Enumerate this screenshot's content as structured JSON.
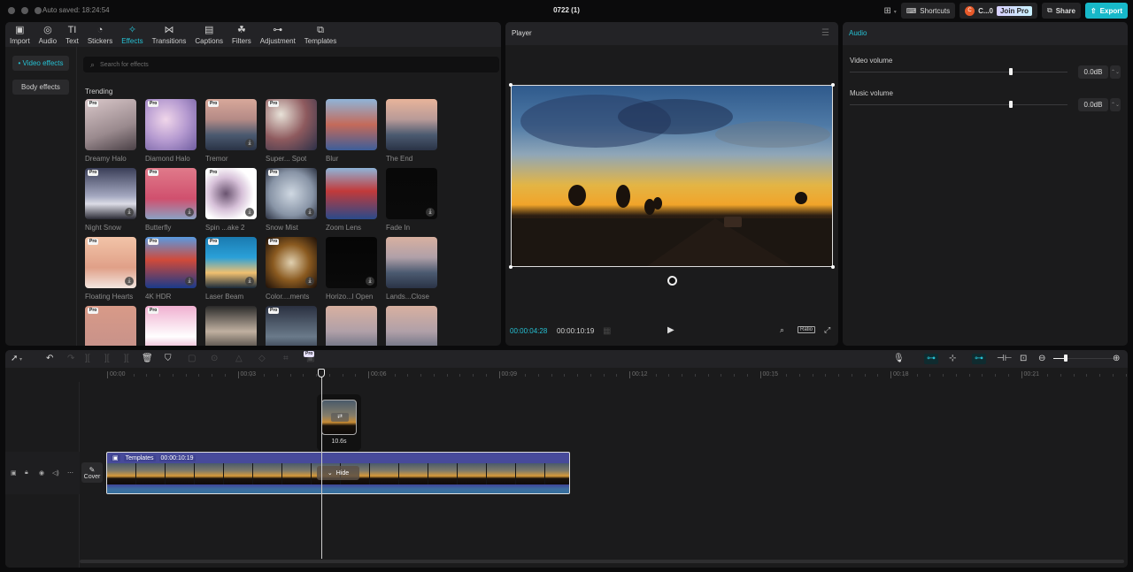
{
  "titlebar": {
    "autosaved": "Auto saved: 18:24:54",
    "doc_title": "0722 (1)",
    "layout_icon": "layout-icon",
    "shortcuts_label": "Shortcuts",
    "user_initial": "C",
    "user_name": "C...0",
    "join_pro_label": "Join Pro",
    "share_label": "Share",
    "export_label": "Export"
  },
  "topnav": [
    {
      "icon": "▣",
      "label": "Import"
    },
    {
      "icon": "◎",
      "label": "Audio"
    },
    {
      "icon": "TI",
      "label": "Text"
    },
    {
      "icon": "◔",
      "label": "Stickers"
    },
    {
      "icon": "✧",
      "label": "Effects",
      "active": true
    },
    {
      "icon": "⋈",
      "label": "Transitions"
    },
    {
      "icon": "▤",
      "label": "Captions"
    },
    {
      "icon": "☘",
      "label": "Filters"
    },
    {
      "icon": "⊶",
      "label": "Adjustment"
    },
    {
      "icon": "⧉",
      "label": "Templates"
    }
  ],
  "subnav": {
    "video_effects": "• Video effects",
    "body_effects": "Body effects"
  },
  "effects": {
    "search_placeholder": "Search for effects",
    "section_title": "Trending",
    "items": [
      {
        "label": "Dreamy Halo",
        "pro": true,
        "download": false
      },
      {
        "label": "Diamond Halo",
        "pro": true,
        "download": false
      },
      {
        "label": "Tremor",
        "pro": true,
        "download": true
      },
      {
        "label": "Super... Spot",
        "pro": true,
        "download": false
      },
      {
        "label": "Blur",
        "pro": false,
        "download": false
      },
      {
        "label": "The End",
        "pro": false,
        "download": false
      },
      {
        "label": "Night Snow",
        "pro": true,
        "download": true
      },
      {
        "label": "Butterfly",
        "pro": true,
        "download": true
      },
      {
        "label": "Spin ...ake 2",
        "pro": true,
        "download": true
      },
      {
        "label": "Snow Mist",
        "pro": true,
        "download": true
      },
      {
        "label": "Zoom Lens",
        "pro": false,
        "download": false
      },
      {
        "label": "Fade In",
        "pro": false,
        "download": true
      },
      {
        "label": "Floating Hearts",
        "pro": true,
        "download": true
      },
      {
        "label": "4K HDR",
        "pro": true,
        "download": true
      },
      {
        "label": "Laser Beam",
        "pro": true,
        "download": true
      },
      {
        "label": "Color....ments",
        "pro": true,
        "download": true
      },
      {
        "label": "Horizo...l Open",
        "pro": false,
        "download": true
      },
      {
        "label": "Lands...Close",
        "pro": false,
        "download": false
      },
      {
        "label": "",
        "pro": true,
        "download": false
      },
      {
        "label": "",
        "pro": true,
        "download": false
      },
      {
        "label": "",
        "pro": false,
        "download": false
      },
      {
        "label": "",
        "pro": true,
        "download": false
      },
      {
        "label": "",
        "pro": false,
        "download": false
      },
      {
        "label": "",
        "pro": false,
        "download": false
      }
    ]
  },
  "player": {
    "title": "Player",
    "current_time": "00:00:04:28",
    "total_time": "00:00:10:19",
    "ratio_label": "Ratio"
  },
  "audio": {
    "title": "Audio",
    "video_volume_label": "Video volume",
    "video_volume_value": "0.0dB",
    "video_volume_level": 0.74,
    "music_volume_label": "Music volume",
    "music_volume_value": "0.0dB",
    "music_volume_level": 0.74
  },
  "timeline": {
    "pro_badge": "Pro",
    "ruler": [
      "00:00",
      "00:03",
      "00:06",
      "00:09",
      "00:12",
      "00:15",
      "00:18",
      "00:21"
    ],
    "zoom_level": 0.2,
    "cover_label": "Cover",
    "clip": {
      "name": "Templates",
      "duration": "00:00:10:19",
      "hide_label": "Hide"
    },
    "preview_duration": "10.6s"
  }
}
